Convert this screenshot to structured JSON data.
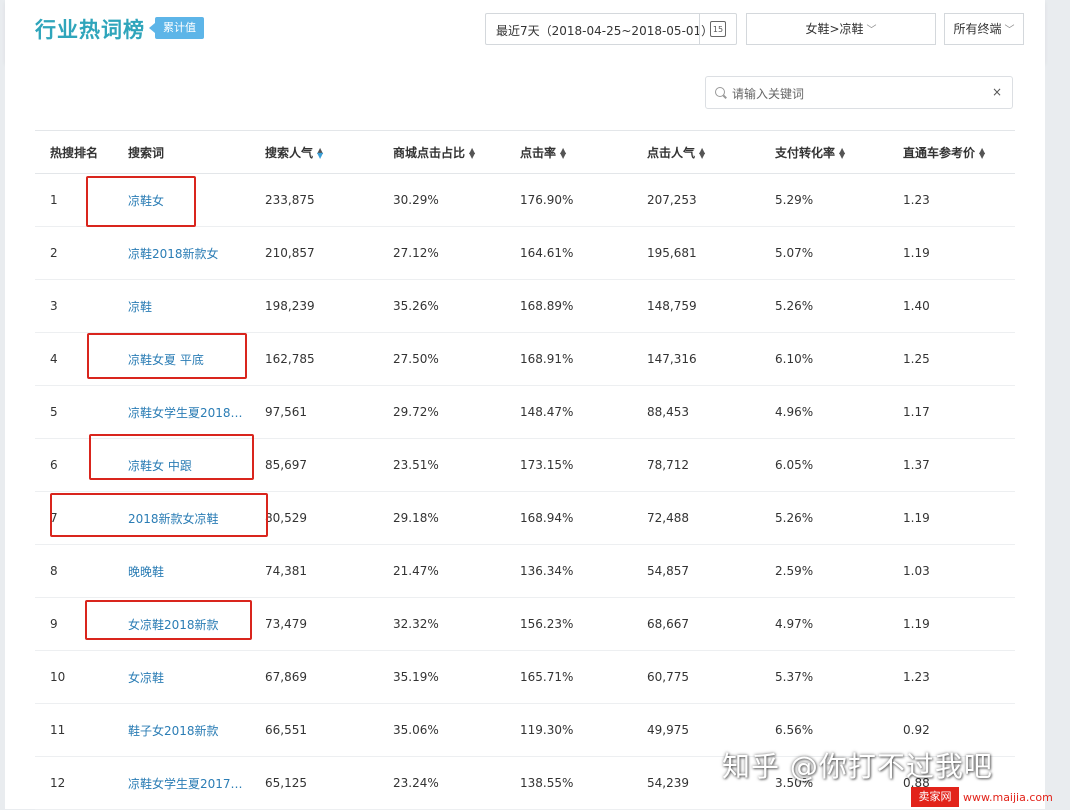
{
  "header": {
    "title": "行业热词榜",
    "badge": "累计值",
    "date_range": "最近7天（2018-04-25~2018-05-01）",
    "calendar_day": "15",
    "category": "女鞋>凉鞋",
    "terminal": "所有终端"
  },
  "search": {
    "placeholder": "请输入关键词",
    "value": "",
    "clear": "×"
  },
  "table": {
    "columns": [
      "热搜排名",
      "搜索词",
      "搜索人气",
      "商城点击占比",
      "点击率",
      "点击人气",
      "支付转化率",
      "直通车参考价"
    ],
    "rows": [
      [
        "1",
        "凉鞋女",
        "233,875",
        "30.29%",
        "176.90%",
        "207,253",
        "5.29%",
        "1.23"
      ],
      [
        "2",
        "凉鞋2018新款女",
        "210,857",
        "27.12%",
        "164.61%",
        "195,681",
        "5.07%",
        "1.19"
      ],
      [
        "3",
        "凉鞋",
        "198,239",
        "35.26%",
        "168.89%",
        "148,759",
        "5.26%",
        "1.40"
      ],
      [
        "4",
        "凉鞋女夏 平底",
        "162,785",
        "27.50%",
        "168.91%",
        "147,316",
        "6.10%",
        "1.25"
      ],
      [
        "5",
        "凉鞋女学生夏2018新...",
        "97,561",
        "29.72%",
        "148.47%",
        "88,453",
        "4.96%",
        "1.17"
      ],
      [
        "6",
        "凉鞋女 中跟",
        "85,697",
        "23.51%",
        "173.15%",
        "78,712",
        "6.05%",
        "1.37"
      ],
      [
        "7",
        "2018新款女凉鞋",
        "80,529",
        "29.18%",
        "168.94%",
        "72,488",
        "5.26%",
        "1.19"
      ],
      [
        "8",
        "晚晚鞋",
        "74,381",
        "21.47%",
        "136.34%",
        "54,857",
        "2.59%",
        "1.03"
      ],
      [
        "9",
        "女凉鞋2018新款",
        "73,479",
        "32.32%",
        "156.23%",
        "68,667",
        "4.97%",
        "1.19"
      ],
      [
        "10",
        "女凉鞋",
        "67,869",
        "35.19%",
        "165.71%",
        "60,775",
        "5.37%",
        "1.23"
      ],
      [
        "11",
        "鞋子女2018新款",
        "66,551",
        "35.06%",
        "119.30%",
        "49,975",
        "6.56%",
        "0.92"
      ],
      [
        "12",
        "凉鞋女学生夏2017新...",
        "65,125",
        "23.24%",
        "138.55%",
        "54,239",
        "3.50%",
        "0.88"
      ]
    ]
  },
  "overlay": {
    "watermark": "知乎 @你打不过我吧",
    "site_logo": "卖家网",
    "site_url": "www.maijia.com",
    "highlight_color": "#d9251d"
  },
  "colors": {
    "accent": "#2fa5bb",
    "link": "#2b7db5",
    "badge": "#5db5e8"
  }
}
